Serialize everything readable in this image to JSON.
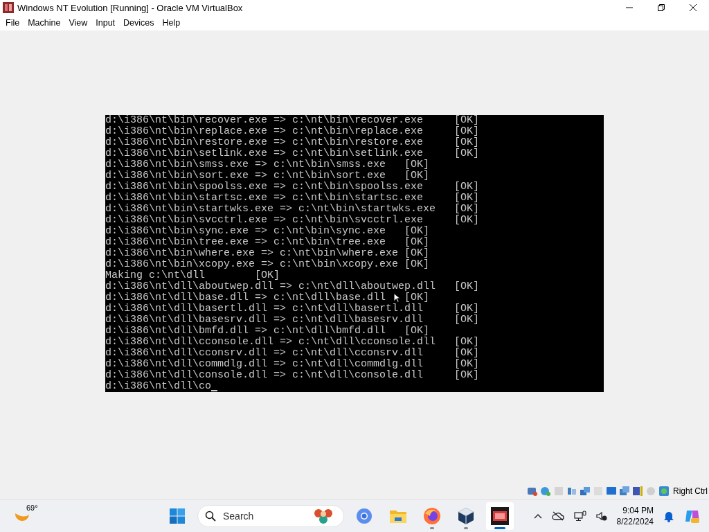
{
  "window": {
    "title": "Windows NT Evolution [Running] - Oracle VM VirtualBox"
  },
  "menu": [
    "File",
    "Machine",
    "View",
    "Input",
    "Devices",
    "Help"
  ],
  "console": {
    "lines": [
      {
        "text": "d:\\i386\\nt\\bin\\recover.exe => c:\\nt\\bin\\recover.exe",
        "status": "[OK]"
      },
      {
        "text": "d:\\i386\\nt\\bin\\replace.exe => c:\\nt\\bin\\replace.exe",
        "status": "[OK]"
      },
      {
        "text": "d:\\i386\\nt\\bin\\restore.exe => c:\\nt\\bin\\restore.exe",
        "status": "[OK]"
      },
      {
        "text": "d:\\i386\\nt\\bin\\setlink.exe => c:\\nt\\bin\\setlink.exe",
        "status": "[OK]"
      },
      {
        "text": "d:\\i386\\nt\\bin\\smss.exe => c:\\nt\\bin\\smss.exe",
        "status": "[OK]"
      },
      {
        "text": "d:\\i386\\nt\\bin\\sort.exe => c:\\nt\\bin\\sort.exe",
        "status": "[OK]"
      },
      {
        "text": "d:\\i386\\nt\\bin\\spoolss.exe => c:\\nt\\bin\\spoolss.exe",
        "status": "[OK]"
      },
      {
        "text": "d:\\i386\\nt\\bin\\startsc.exe => c:\\nt\\bin\\startsc.exe",
        "status": "[OK]"
      },
      {
        "text": "d:\\i386\\nt\\bin\\startwks.exe => c:\\nt\\bin\\startwks.exe",
        "status": "[OK]"
      },
      {
        "text": "d:\\i386\\nt\\bin\\svcctrl.exe => c:\\nt\\bin\\svcctrl.exe",
        "status": "[OK]"
      },
      {
        "text": "d:\\i386\\nt\\bin\\sync.exe => c:\\nt\\bin\\sync.exe",
        "status": "[OK]"
      },
      {
        "text": "d:\\i386\\nt\\bin\\tree.exe => c:\\nt\\bin\\tree.exe",
        "status": "[OK]"
      },
      {
        "text": "d:\\i386\\nt\\bin\\where.exe => c:\\nt\\bin\\where.exe",
        "status": "[OK]"
      },
      {
        "text": "d:\\i386\\nt\\bin\\xcopy.exe => c:\\nt\\bin\\xcopy.exe",
        "status": "[OK]"
      },
      {
        "text": "Making c:\\nt\\dll",
        "status": "[OK]"
      },
      {
        "text": "d:\\i386\\nt\\dll\\aboutwep.dll => c:\\nt\\dll\\aboutwep.dll",
        "status": "[OK]"
      },
      {
        "text": "d:\\i386\\nt\\dll\\base.dll => c:\\nt\\dll\\base.dll",
        "status": "[OK]"
      },
      {
        "text": "d:\\i386\\nt\\dll\\basertl.dll => c:\\nt\\dll\\basertl.dll",
        "status": "[OK]"
      },
      {
        "text": "d:\\i386\\nt\\dll\\basesrv.dll => c:\\nt\\dll\\basesrv.dll",
        "status": "[OK]"
      },
      {
        "text": "d:\\i386\\nt\\dll\\bmfd.dll => c:\\nt\\dll\\bmfd.dll",
        "status": "[OK]"
      },
      {
        "text": "d:\\i386\\nt\\dll\\cconsole.dll => c:\\nt\\dll\\cconsole.dll",
        "status": "[OK]"
      },
      {
        "text": "d:\\i386\\nt\\dll\\cconsrv.dll => c:\\nt\\dll\\cconsrv.dll",
        "status": "[OK]"
      },
      {
        "text": "d:\\i386\\nt\\dll\\commdlg.dll => c:\\nt\\dll\\commdlg.dll",
        "status": "[OK]"
      },
      {
        "text": "d:\\i386\\nt\\dll\\console.dll => c:\\nt\\dll\\console.dll",
        "status": "[OK]"
      }
    ],
    "prompt": "d:\\i386\\nt\\dll\\co"
  },
  "status_bar": {
    "host_key": "Right Ctrl"
  },
  "taskbar": {
    "weather": "69°",
    "search": {
      "placeholder": "Search"
    },
    "apps": [
      {
        "kind": "browser",
        "running": false,
        "selected": false
      },
      {
        "kind": "folder",
        "running": false,
        "selected": false
      },
      {
        "kind": "firefox",
        "running": true,
        "selected": false
      },
      {
        "kind": "cube",
        "running": true,
        "selected": false
      },
      {
        "kind": "dos",
        "running": true,
        "selected": true
      }
    ],
    "time": "9:04 PM",
    "date": "8/22/2024"
  }
}
